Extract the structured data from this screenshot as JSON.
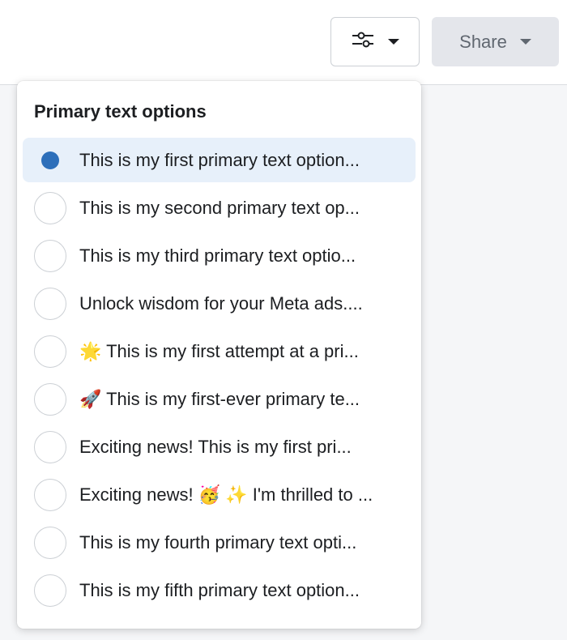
{
  "toolbar": {
    "filter_icon": "sliders-icon",
    "share_label": "Share"
  },
  "dropdown": {
    "title": "Primary text options",
    "selected_index": 0,
    "options": [
      {
        "label": "This is my first primary text option..."
      },
      {
        "label": "This is my second primary text op..."
      },
      {
        "label": "This is my third primary text optio..."
      },
      {
        "label": "Unlock wisdom for your Meta ads...."
      },
      {
        "label": "🌟 This is my first attempt at a pri..."
      },
      {
        "label": "🚀 This is my first-ever primary te..."
      },
      {
        "label": "Exciting news! This is my first pri..."
      },
      {
        "label": "Exciting news! 🥳 ✨ I'm thrilled to ..."
      },
      {
        "label": "This is my fourth primary text opti..."
      },
      {
        "label": "This is my fifth primary text option..."
      }
    ]
  },
  "colors": {
    "accent": "#2d6fba",
    "selected_bg": "#e7f0fa"
  }
}
